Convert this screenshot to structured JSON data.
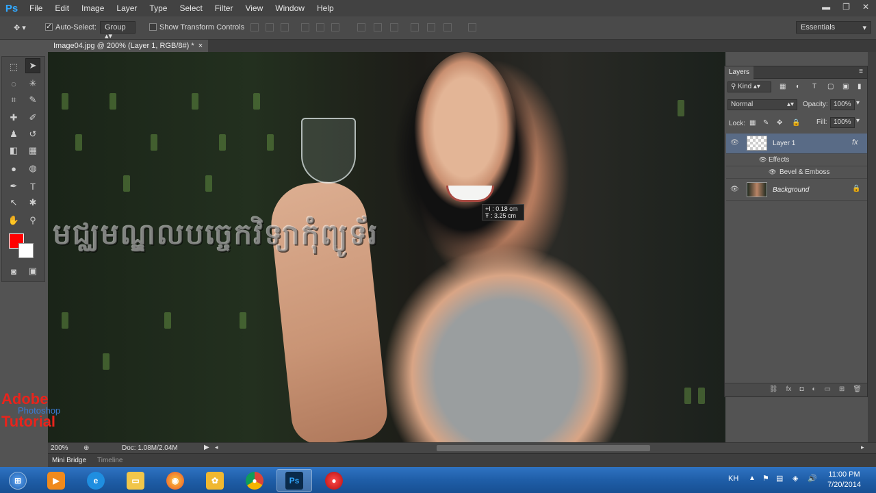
{
  "app": {
    "logo": "Ps"
  },
  "menu": [
    "File",
    "Edit",
    "Image",
    "Layer",
    "Type",
    "Select",
    "Filter",
    "View",
    "Window",
    "Help"
  ],
  "window_controls": {
    "minimize": "▬",
    "restore": "❐",
    "close": "✕"
  },
  "options": {
    "auto_select_label": "Auto-Select:",
    "auto_select_checked": true,
    "auto_select_value": "Group",
    "transform_label": "Show Transform Controls",
    "workspace": "Essentials"
  },
  "document_tab": {
    "title": "Image04.jpg @ 200% (Layer 1, RGB/8#) *",
    "close": "×"
  },
  "canvas": {
    "text_effect": "មជ្ឈមណ្ឌលបច្ចេកវិទ្យាកុំព្យូទ័រ",
    "measure_tip": {
      "line1": "+I : 0.18 cm",
      "line2": "Ŧ : 3.25 cm"
    },
    "watermark": {
      "line1": "Adobe",
      "line2": "Photoshop",
      "line3": "Tutorial"
    },
    "dots": ". . . ."
  },
  "status": {
    "zoom": "200%",
    "doc": "Doc: 1.08M/2.04M"
  },
  "bottom_tabs": [
    "Mini Bridge",
    "Timeline"
  ],
  "layers_panel": {
    "title": "Layers",
    "kind_filter": "Kind",
    "blend_mode": "Normal",
    "opacity_label": "Opacity:",
    "opacity_value": "100%",
    "lock_label": "Lock:",
    "fill_label": "Fill:",
    "fill_value": "100%",
    "layers": [
      {
        "name": "Layer 1",
        "fx": "fx",
        "selected": true
      },
      {
        "name": "Background",
        "locked": true
      }
    ],
    "effects_label": "Effects",
    "effect_item": "Bevel & Emboss"
  },
  "taskbar": {
    "language": "KH",
    "time": "11:00 PM",
    "date": "7/20/2014"
  }
}
